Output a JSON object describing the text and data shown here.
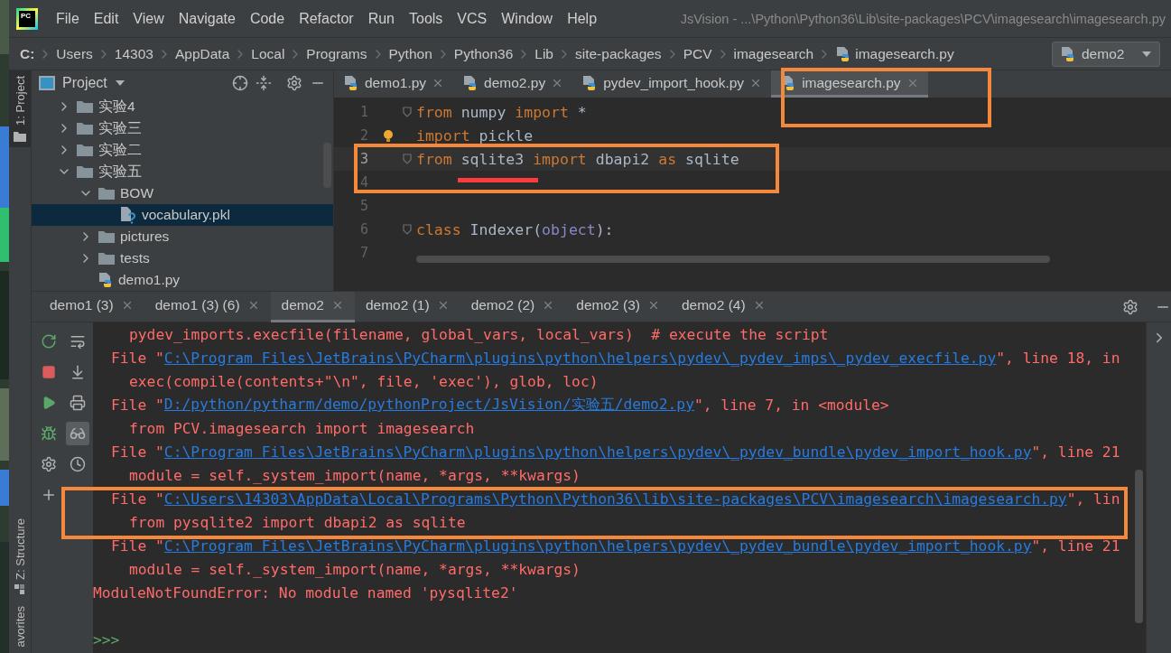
{
  "window": {
    "logo": "PC",
    "title": "JsVision - ...\\Python\\Python36\\Lib\\site-packages\\PCV\\imagesearch\\imagesearch.py"
  },
  "menu": [
    "File",
    "Edit",
    "View",
    "Navigate",
    "Code",
    "Refactor",
    "Run",
    "Tools",
    "VCS",
    "Window",
    "Help"
  ],
  "breadcrumb": {
    "segments": [
      "C:",
      "Users",
      "14303",
      "AppData",
      "Local",
      "Programs",
      "Python",
      "Python36",
      "Lib",
      "site-packages",
      "PCV",
      "imagesearch"
    ],
    "file": "imagesearch.py"
  },
  "run_config": {
    "label": "demo2"
  },
  "side_strip": {
    "top": [
      {
        "label": "1: Project",
        "selected": true
      }
    ],
    "bottom": [
      {
        "label": "Z: Structure",
        "selected": false
      },
      {
        "label": "avorites",
        "selected": false
      }
    ]
  },
  "project_panel": {
    "title": "Project",
    "tree": [
      {
        "label": "实验4",
        "kind": "folder",
        "expanded": false,
        "selected": false
      },
      {
        "label": "实验三",
        "kind": "folder",
        "expanded": false,
        "selected": false
      },
      {
        "label": "实验二",
        "kind": "folder",
        "expanded": false,
        "selected": false
      },
      {
        "label": "实验五",
        "kind": "folder",
        "expanded": true,
        "selected": false,
        "children": [
          {
            "label": "BOW",
            "kind": "folder",
            "expanded": true,
            "selected": false,
            "children": [
              {
                "label": "vocabulary.pkl",
                "kind": "unknown_file",
                "selected": true
              }
            ]
          },
          {
            "label": "pictures",
            "kind": "folder",
            "expanded": false,
            "selected": false
          },
          {
            "label": "tests",
            "kind": "folder",
            "expanded": false,
            "selected": false
          },
          {
            "label": "demo1.py",
            "kind": "python_file",
            "selected": false
          }
        ]
      }
    ]
  },
  "editor": {
    "tabs": [
      {
        "label": "demo1.py",
        "selected": false
      },
      {
        "label": "demo2.py",
        "selected": false
      },
      {
        "label": "pydev_import_hook.py",
        "selected": false
      },
      {
        "label": "imagesearch.py",
        "selected": true
      }
    ],
    "lines": [
      {
        "number": "1",
        "current": false,
        "fold": true,
        "tokens": [
          {
            "kind": "keyword",
            "text": "from"
          },
          {
            "kind": "plain",
            "text": " numpy "
          },
          {
            "kind": "keyword",
            "text": "import"
          },
          {
            "kind": "plain",
            "text": " *"
          }
        ]
      },
      {
        "number": "2",
        "current": false,
        "fold": false,
        "bulb": true,
        "tokens": [
          {
            "kind": "keyword",
            "text": "import"
          },
          {
            "kind": "plain",
            "text": " pickle"
          }
        ]
      },
      {
        "number": "3",
        "current": true,
        "fold": true,
        "tokens": [
          {
            "kind": "keyword",
            "text": "from"
          },
          {
            "kind": "plain",
            "text": " sqlite3 "
          },
          {
            "kind": "keyword",
            "text": "import"
          },
          {
            "kind": "plain",
            "text": " dbapi2 "
          },
          {
            "kind": "keyword",
            "text": "as"
          },
          {
            "kind": "plain",
            "text": " sqlite"
          }
        ]
      },
      {
        "number": "4",
        "current": false,
        "fold": false
      },
      {
        "number": "5",
        "current": false,
        "fold": false
      },
      {
        "number": "6",
        "current": false,
        "fold": true,
        "tokens": [
          {
            "kind": "keyword",
            "text": "class"
          },
          {
            "kind": "plain",
            "text": " Indexer("
          },
          {
            "kind": "builtin",
            "text": "object"
          },
          {
            "kind": "plain",
            "text": "):"
          }
        ]
      },
      {
        "number": "7",
        "current": false,
        "fold": false
      }
    ]
  },
  "run": {
    "tabs": [
      {
        "label": "demo1 (3)",
        "selected": false
      },
      {
        "label": "demo1 (3) (6)",
        "selected": false
      },
      {
        "label": "demo2",
        "selected": true
      },
      {
        "label": "demo2 (1)",
        "selected": false
      },
      {
        "label": "demo2 (2)",
        "selected": false
      },
      {
        "label": "demo2 (3)",
        "selected": false
      },
      {
        "label": "demo2 (4)",
        "selected": false
      }
    ],
    "toggles": [
      {
        "selected": false
      },
      {
        "selected": false
      },
      {
        "selected": false
      },
      {
        "selected": true
      },
      {
        "selected": false
      }
    ],
    "console": [
      {
        "kind": "code",
        "parts": [
          {
            "text": "pydev_imports.execfile(filename, global_vars, local_vars)  # execute the script"
          }
        ]
      },
      {
        "kind": "file",
        "parts": [
          {
            "text": "File \""
          },
          {
            "text": "C:\\Program Files\\JetBrains\\PyCharm\\plugins\\python\\helpers\\pydev\\_pydev_imps\\_pydev_execfile.py",
            "link": true
          },
          {
            "text": "\", line 18, in"
          }
        ]
      },
      {
        "kind": "code",
        "parts": [
          {
            "text": "exec(compile(contents+\"\\n\", file, 'exec'), glob, loc)"
          }
        ]
      },
      {
        "kind": "file",
        "parts": [
          {
            "text": "File \""
          },
          {
            "text": "D:/python/pytharm/demo/pythonProject/JsVision/实验五/demo2.py",
            "link": true
          },
          {
            "text": "\", line 7, in <module>"
          }
        ]
      },
      {
        "kind": "code",
        "parts": [
          {
            "text": "from PCV.imagesearch import imagesearch"
          }
        ]
      },
      {
        "kind": "file",
        "parts": [
          {
            "text": "File \""
          },
          {
            "text": "C:\\Program Files\\JetBrains\\PyCharm\\plugins\\python\\helpers\\pydev\\_pydev_bundle\\pydev_import_hook.py",
            "link": true
          },
          {
            "text": "\", line 21"
          }
        ]
      },
      {
        "kind": "code",
        "parts": [
          {
            "text": "module = self._system_import(name, *args, **kwargs)"
          }
        ]
      },
      {
        "kind": "file",
        "parts": [
          {
            "text": "File \""
          },
          {
            "text": "C:\\Users\\14303\\AppData\\Local\\Programs\\Python\\Python36\\lib\\site-packages\\PCV\\imagesearch\\imagesearch.py",
            "link": true
          },
          {
            "text": "\", lin"
          }
        ]
      },
      {
        "kind": "code",
        "parts": [
          {
            "text": "from pysqlite2 import dbapi2 as sqlite"
          }
        ]
      },
      {
        "kind": "file",
        "parts": [
          {
            "text": "File \""
          },
          {
            "text": "C:\\Program Files\\JetBrains\\PyCharm\\plugins\\python\\helpers\\pydev\\_pydev_bundle\\pydev_import_hook.py",
            "link": true
          },
          {
            "text": "\", line 21"
          }
        ]
      },
      {
        "kind": "code",
        "parts": [
          {
            "text": "module = self._system_import(name, *args, **kwargs)"
          }
        ]
      },
      {
        "kind": "error",
        "parts": [
          {
            "text": "ModuleNotFoundError: No module named 'pysqlite2'"
          }
        ]
      },
      {
        "kind": "blank"
      },
      {
        "kind": "prompt",
        "parts": [
          {
            "text": ">>>"
          }
        ]
      }
    ]
  }
}
